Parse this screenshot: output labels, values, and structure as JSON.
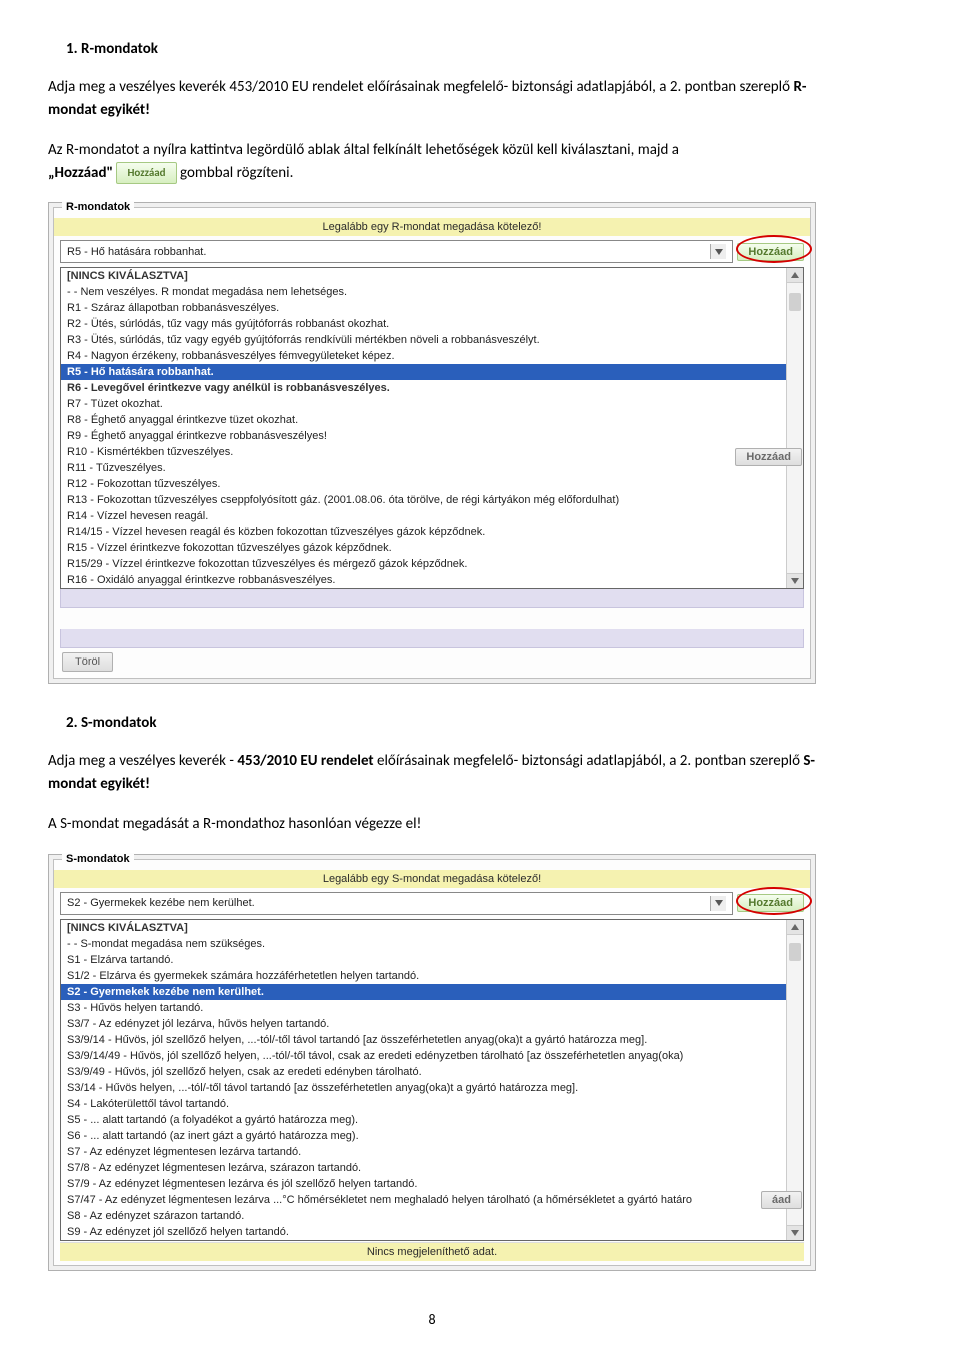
{
  "section1": {
    "title": "1.  R-mondatok",
    "p1_a": "Adja meg a veszélyes keverék 453/2010 EU rendelet előírásainak megfelelő- biztonsági adatlapjából, a 2. pontban szereplő ",
    "p1_b": "R-mondat egyikét!",
    "p2_a": "Az R-mondatot a nyílra kattintva legördülő ablak által felkínált lehetőségek közül kell kiválasztani, majd a ",
    "p2_quote": "„Hozzáad\" ",
    "p2_badge": "Hozzáad",
    "p2_b": " gombbal rögzíteni."
  },
  "shot1": {
    "fieldset": "R-mondatok",
    "yellow": "Legalább egy R-mondat megadása kötelező!",
    "selected": "R5 - Hő hatására robbanhat.",
    "add": "Hozzáad",
    "dd": [
      {
        "cls": "bold",
        "t": "[NINCS KIVÁLASZTVA]"
      },
      {
        "cls": "",
        "t": "- - Nem veszélyes. R mondat megadása nem lehetséges."
      },
      {
        "cls": "",
        "t": "R1 - Száraz állapotban robbanásveszélyes."
      },
      {
        "cls": "",
        "t": "R2 - Ütés, súrlódás, tűz vagy más gyújtóforrás robbanást okozhat."
      },
      {
        "cls": "",
        "t": "R3 - Ütés, súrlódás, tűz vagy egyéb gyújtóforrás rendkívüli mértékben növeli a robbanásveszélyt."
      },
      {
        "cls": "",
        "t": "R4 - Nagyon érzékeny, robbanásveszélyes fémvegyületeket képez."
      },
      {
        "cls": "sel",
        "t": "R5 - Hő hatására robbanhat."
      },
      {
        "cls": "bold",
        "t": "R6 - Levegővel érintkezve vagy anélkül is robbanásveszélyes."
      },
      {
        "cls": "",
        "t": "R7 - Tüzet okozhat."
      },
      {
        "cls": "",
        "t": "R8 - Éghető anyaggal érintkezve tüzet okozhat."
      },
      {
        "cls": "",
        "t": "R9 - Éghető anyaggal érintkezve robbanásveszélyes!"
      },
      {
        "cls": "",
        "t": "R10 - Kismértékben tűzveszélyes."
      },
      {
        "cls": "",
        "t": "R11 - Tűzveszélyes."
      },
      {
        "cls": "",
        "t": "R12 - Fokozottan tűzveszélyes."
      },
      {
        "cls": "",
        "t": "R13 - Fokozottan tűzveszélyes cseppfolyósított gáz. (2001.08.06. óta törölve, de régi kártyákon még előfordulhat)"
      },
      {
        "cls": "",
        "t": "R14 - Vízzel hevesen reagál."
      },
      {
        "cls": "",
        "t": "R14/15 - Vízzel hevesen reagál és közben fokozottan tűzveszélyes gázok képződnek."
      },
      {
        "cls": "",
        "t": "R15 - Vízzel érintkezve fokozottan tűzveszélyes gázok képződnek."
      },
      {
        "cls": "",
        "t": "R15/29 - Vízzel érintkezve fokozottan tűzveszélyes és mérgező gázok képződnek."
      },
      {
        "cls": "",
        "t": "R16 - Oxidáló anyaggal érintkezve robbanásveszélyes."
      }
    ],
    "side_add": "Hozzáad",
    "torol": "Töröl"
  },
  "section2": {
    "title": "2.  S-mondatok",
    "p1_a": "Adja meg a veszélyes keverék - ",
    "p1_b": "453/2010 EU rendelet",
    "p1_c": " előírásainak megfelelő- biztonsági adatlapjából, a 2. pontban szereplő ",
    "p1_d": "S-mondat egyikét!",
    "p2": "A S-mondat megadását a R-mondathoz hasonlóan végezze el!"
  },
  "shot2": {
    "fieldset": "S-mondatok",
    "yellow": "Legalább egy S-mondat megadása kötelező!",
    "selected": "S2 - Gyermekek kezébe nem kerülhet.",
    "add": "Hozzáad",
    "dd": [
      {
        "cls": "bold",
        "t": "[NINCS KIVÁLASZTVA]"
      },
      {
        "cls": "",
        "t": "- - S-mondat megadása nem szükséges."
      },
      {
        "cls": "",
        "t": "S1 - Elzárva tartandó."
      },
      {
        "cls": "",
        "t": "S1/2 - Elzárva és gyermekek számára hozzáférhetetlen helyen tartandó."
      },
      {
        "cls": "sel",
        "t": "S2 - Gyermekek kezébe nem kerülhet."
      },
      {
        "cls": "",
        "t": "S3 - Hűvös helyen tartandó."
      },
      {
        "cls": "",
        "t": "S3/7 - Az edényzet jól lezárva, hűvös helyen tartandó."
      },
      {
        "cls": "",
        "t": "S3/9/14 - Hűvös, jól szellőző helyen, ...-tól/-től távol tartandó [az összeférhetetlen anyag(oka)t a gyártó határozza meg]."
      },
      {
        "cls": "",
        "t": "S3/9/14/49 - Hűvös, jól szellőző helyen, ...-tól/-től távol, csak az eredeti edényzetben tárolható [az összeférhetetlen anyag(oka)"
      },
      {
        "cls": "",
        "t": "S3/9/49 - Hűvös, jól szellőző helyen, csak az eredeti edényben tárolható."
      },
      {
        "cls": "",
        "t": "S3/14 - Hűvös helyen, ...-tól/-től távol tartandó [az összeférhetetlen anyag(oka)t a gyártó határozza meg]."
      },
      {
        "cls": "",
        "t": "S4 - Lakóterülettől távol tartandó."
      },
      {
        "cls": "",
        "t": "S5 - ... alatt tartandó (a folyadékot a gyártó határozza meg)."
      },
      {
        "cls": "",
        "t": "S6 - ... alatt tartandó (az inert gázt a gyártó határozza meg)."
      },
      {
        "cls": "",
        "t": "S7 - Az edényzet légmentesen lezárva tartandó."
      },
      {
        "cls": "",
        "t": "S7/8 - Az edényzet légmentesen lezárva, szárazon tartandó."
      },
      {
        "cls": "",
        "t": "S7/9 - Az edényzet légmentesen lezárva és jól szellőző helyen tartandó."
      },
      {
        "cls": "",
        "t": "S7/47 - Az edényzet légmentesen lezárva ...°C hőmérsékletet nem meghaladó helyen tárolható (a hőmérsékletet a gyártó határo"
      },
      {
        "cls": "",
        "t": "S8 - Az edényzet szárazon tartandó."
      },
      {
        "cls": "",
        "t": "S9 - Az edényzet jól szellőző helyen tartandó."
      }
    ],
    "side_add": "áad",
    "nincs": "Nincs megjeleníthető adat."
  },
  "page": "8"
}
